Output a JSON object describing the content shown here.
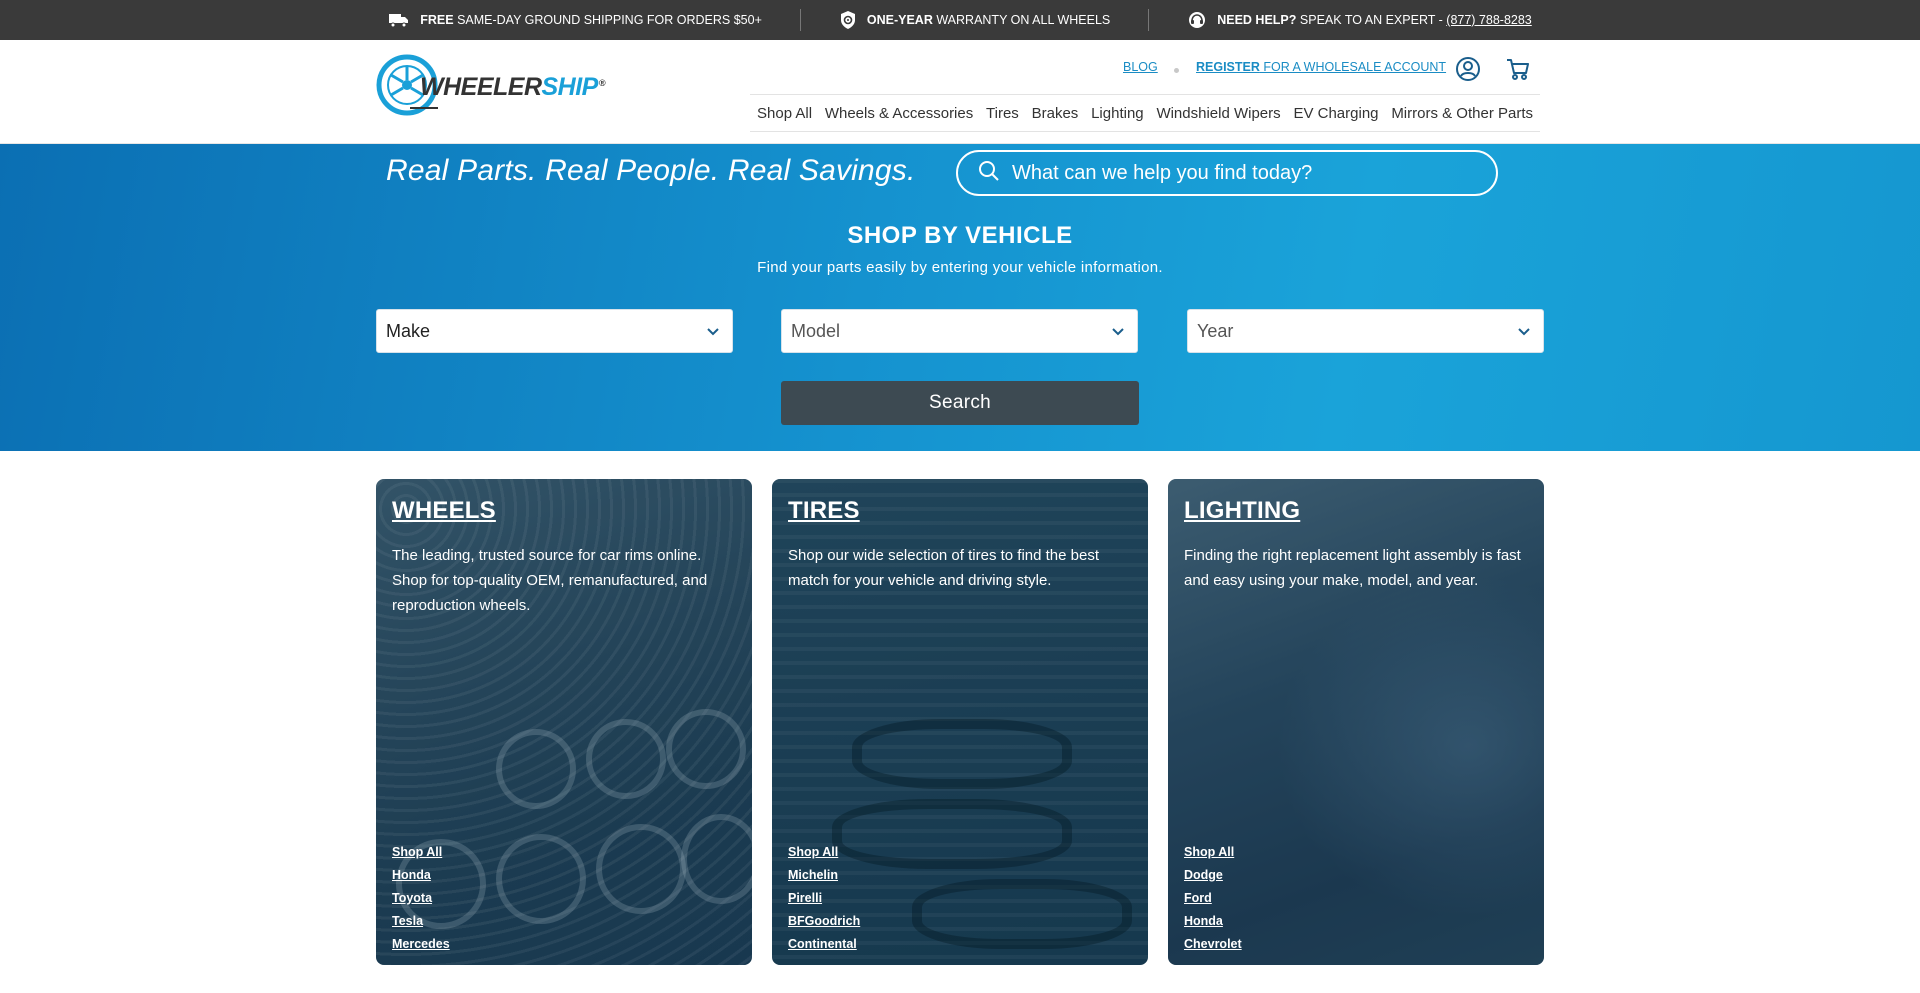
{
  "topbar": {
    "shipping_bold": "FREE",
    "shipping_text": "SAME-DAY GROUND SHIPPING FOR ORDERS $50+",
    "warranty_bold": "ONE-YEAR",
    "warranty_text": "WARRANTY ON ALL WHEELS",
    "help_bold": "NEED HELP?",
    "help_text": "SPEAK TO AN EXPERT -",
    "phone": "(877) 788-8283"
  },
  "header": {
    "logo_main": "WHEELER",
    "logo_accent": "SHIP",
    "logo_mark": "®",
    "blog_label": "BLOG",
    "register_bold": "REGISTER",
    "register_text": " FOR A WHOLESALE ACCOUNT"
  },
  "nav": {
    "items": [
      "Shop All",
      "Wheels & Accessories",
      "Tires",
      "Brakes",
      "Lighting",
      "Windshield Wipers",
      "EV Charging",
      "Mirrors & Other Parts"
    ]
  },
  "hero": {
    "tagline": "Real Parts. Real People. Real Savings.",
    "search_placeholder": "What can we help you find today?",
    "title": "SHOP BY VEHICLE",
    "subtitle": "Find your parts easily by entering your vehicle information.",
    "make_label": "Make",
    "model_label": "Model",
    "year_label": "Year",
    "search_button": "Search"
  },
  "cards": [
    {
      "title": "WHEELS",
      "description": "The leading, trusted source for car rims online. Shop for top-quality OEM, remanufactured, and reproduction wheels.",
      "links": [
        "Shop All",
        "Honda",
        "Toyota",
        "Tesla",
        "Mercedes"
      ]
    },
    {
      "title": "TIRES",
      "description": "Shop our wide selection of tires to find the best match for your vehicle and driving style.",
      "links": [
        "Shop All",
        "Michelin",
        "Pirelli",
        "BFGoodrich",
        "Continental"
      ]
    },
    {
      "title": "LIGHTING",
      "description": "Finding the right replacement light assembly is fast and easy using your make, model, and year.",
      "links": [
        "Shop All",
        "Dodge",
        "Ford",
        "Honda",
        "Chevrolet"
      ]
    }
  ],
  "colors": {
    "accent": "#1aa0d8",
    "topbar_bg": "#3a3a3a",
    "button_bg": "#3d4a52",
    "hero_bg": "#1592cf"
  },
  "icons": {
    "shipping": "truck-icon",
    "warranty": "shield-wheel-icon",
    "help": "headset-icon",
    "account": "user-icon",
    "cart": "cart-icon",
    "search": "search-icon",
    "dropdown": "chevron-down-icon"
  }
}
